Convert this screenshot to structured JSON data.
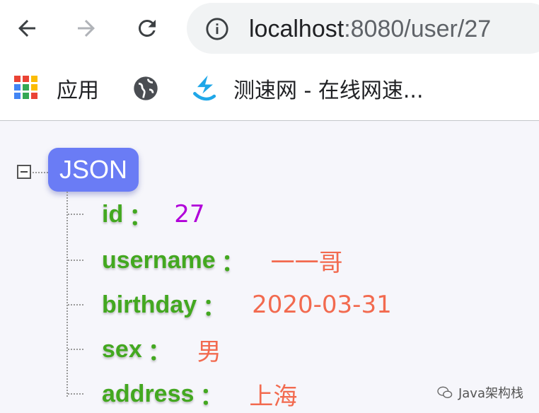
{
  "browser": {
    "url_host": "localhost",
    "url_rest": ":8080/user/27"
  },
  "bookmarks": [
    {
      "label": "应用",
      "icon": "apps-grid-icon"
    },
    {
      "label": "",
      "icon": "globe-icon"
    },
    {
      "label": "测速网 - 在线网速...",
      "icon": "speedtest-icon"
    }
  ],
  "json_viewer": {
    "root_label": "JSON",
    "fields": [
      {
        "key": "id",
        "value": "27",
        "type": "number"
      },
      {
        "key": "username",
        "value": "一一哥",
        "type": "string"
      },
      {
        "key": "birthday",
        "value": "2020-03-31",
        "type": "string"
      },
      {
        "key": "sex",
        "value": "男",
        "type": "string"
      },
      {
        "key": "address",
        "value": "上海",
        "type": "string"
      }
    ],
    "colon": "："
  },
  "colors": {
    "key": "#43a820",
    "number_value": "#b100d9",
    "string_value": "#f26a4f",
    "root_badge": "#6a7cf5"
  },
  "watermark": {
    "text": "Java架构栈"
  }
}
